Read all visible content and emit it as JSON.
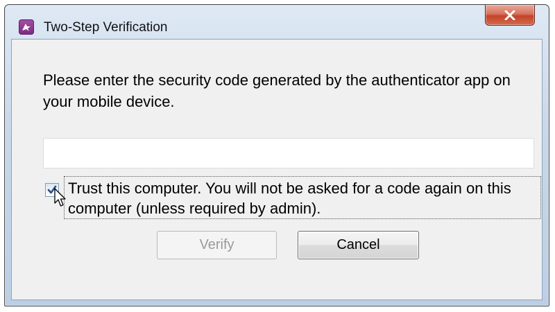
{
  "window": {
    "title": "Two-Step Verification",
    "app_icon": "app-logo-icon",
    "close_icon": "close-icon",
    "close_accent": "#c4432a"
  },
  "dialog": {
    "message": "Please enter the security code generated by the authenticator app on your mobile device.",
    "code_input": {
      "value": "",
      "placeholder": ""
    },
    "trust_checkbox": {
      "checked": true,
      "label": "Trust this computer. You will not be asked for a code again on this computer (unless required by admin)."
    },
    "buttons": {
      "verify_label": "Verify",
      "verify_enabled": false,
      "cancel_label": "Cancel"
    }
  }
}
